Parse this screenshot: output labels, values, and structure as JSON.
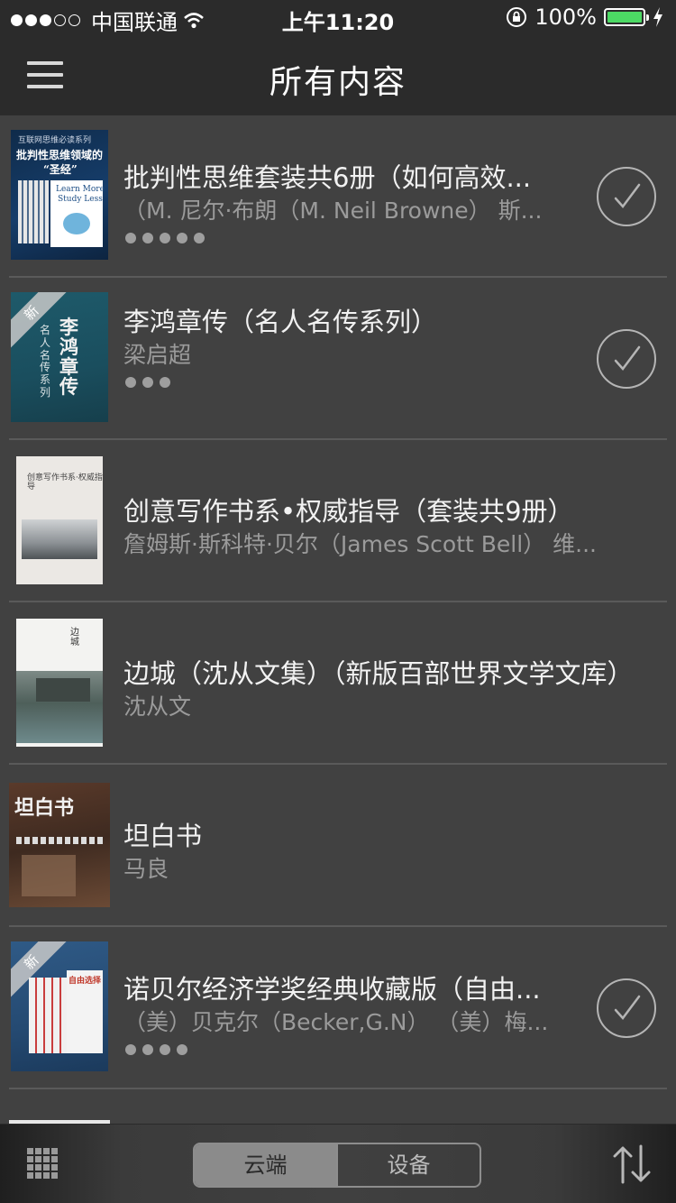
{
  "status_bar": {
    "carrier": "中国联通",
    "time": "上午11:20",
    "battery": "100%"
  },
  "header": {
    "title": "所有内容"
  },
  "books": [
    {
      "title": "批判性思维套装共6册（如何高效...",
      "author": "（M. 尼尔·布朗（M. Neil Browne） 斯...",
      "cover_lines": [
        "互联网思维必读系列",
        "批判性思维领域的",
        "“圣经”",
        "Learn More",
        "Study Less"
      ],
      "is_new": false,
      "progress_dots": 5,
      "downloaded": true
    },
    {
      "title": "李鸿章传（名人名传系列）",
      "author": "梁启超",
      "cover_lines": [
        "新",
        "李鸿章传",
        "名人名传系列"
      ],
      "is_new": true,
      "progress_dots": 3,
      "downloaded": true
    },
    {
      "title": "创意写作书系•权威指导（套装共9册）",
      "author": "詹姆斯·斯科特·贝尔（James Scott Bell） 维...",
      "cover_lines": [
        "创意写作书系·权威指导"
      ],
      "is_new": false,
      "progress_dots": 0,
      "downloaded": false
    },
    {
      "title": "边城（沈从文集）（新版百部世界文学文库）",
      "author": "沈从文",
      "cover_lines": [
        "边城"
      ],
      "is_new": false,
      "progress_dots": 0,
      "downloaded": false
    },
    {
      "title": "坦白书",
      "author": "马良",
      "cover_lines": [
        "坦白书"
      ],
      "is_new": false,
      "progress_dots": 0,
      "downloaded": false
    },
    {
      "title": "诺贝尔经济学奖经典收藏版（自由...",
      "author": "（美）贝克尔（Becker,G.N） （美）梅...",
      "cover_lines": [
        "新",
        "自由选择"
      ],
      "is_new": true,
      "progress_dots": 4,
      "downloaded": true
    }
  ],
  "tabs": {
    "cloud": "云端",
    "device": "设备",
    "active": "cloud"
  },
  "icons": {
    "menu": "menu-icon",
    "check": "check-circle-icon",
    "grid": "grid-view-icon",
    "sort": "sort-icon",
    "wifi": "wifi-icon",
    "lock": "rotation-lock-icon",
    "charging": "charging-bolt-icon"
  },
  "colors": {
    "background": "#414141",
    "bars": "#2b2b2b",
    "battery": "#4cd964"
  }
}
